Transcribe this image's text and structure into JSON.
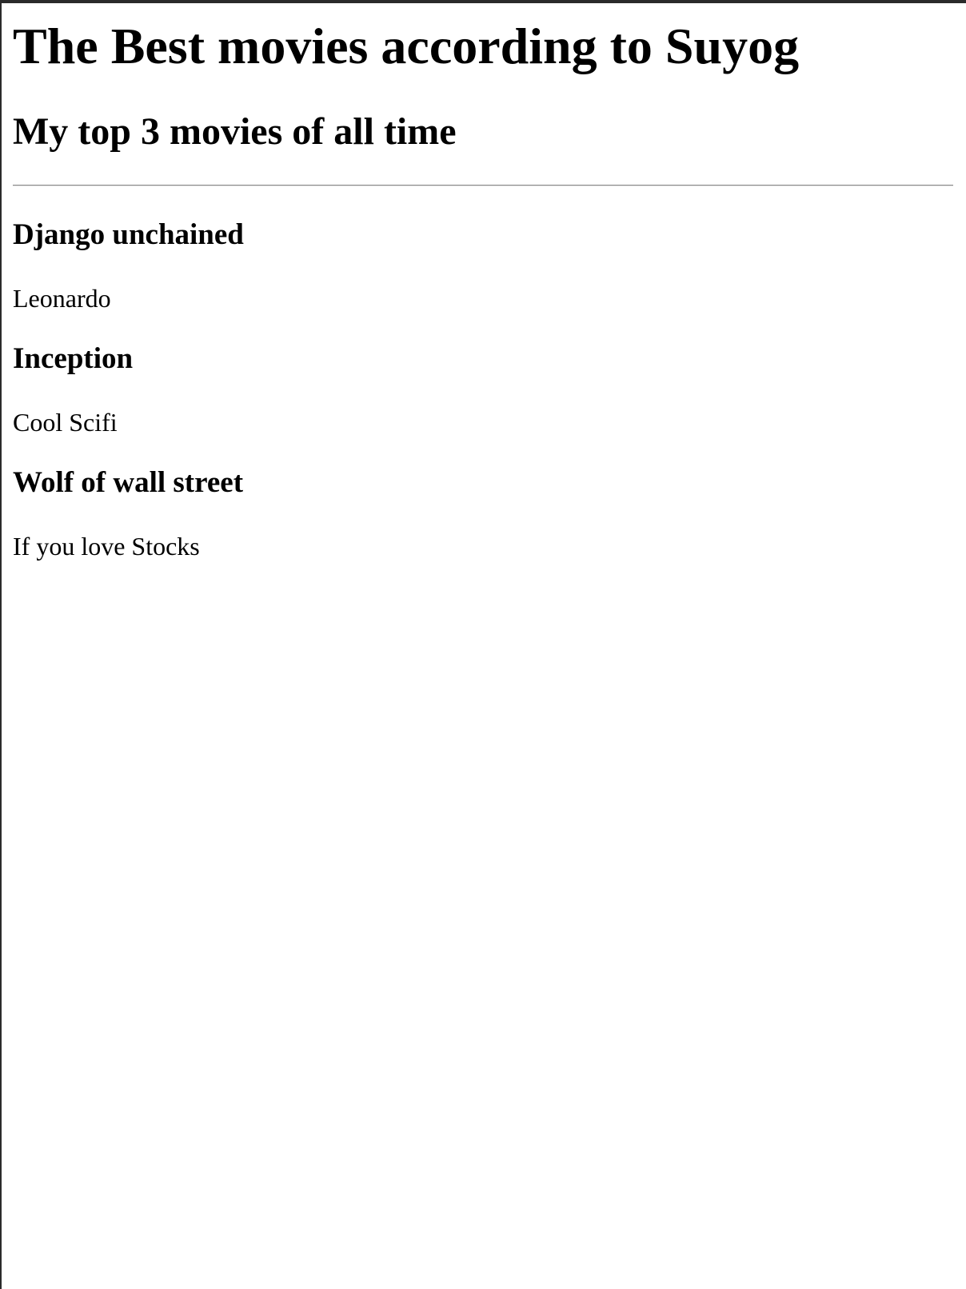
{
  "page": {
    "title": "The Best movies according to Suyog",
    "subtitle": "My top 3 movies of all time"
  },
  "movies": [
    {
      "title": "Django unchained",
      "description": "Leonardo"
    },
    {
      "title": "Inception",
      "description": "Cool Scifi"
    },
    {
      "title": "Wolf of wall street",
      "description": "If you love Stocks"
    }
  ]
}
